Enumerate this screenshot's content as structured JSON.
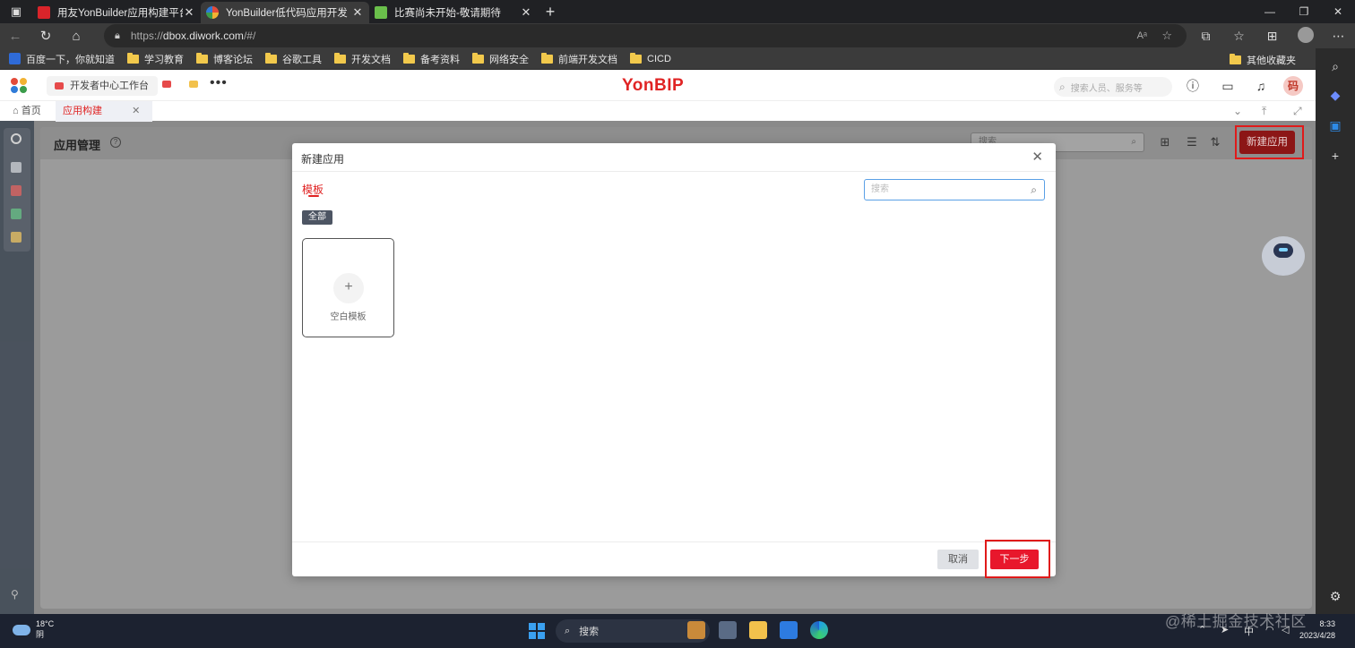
{
  "browser": {
    "tabs": [
      {
        "title": "用友YonBuilder应用构建平台-可可",
        "active": false,
        "favicon_color": "#d9242a"
      },
      {
        "title": "YonBuilder低代码应用开发",
        "active": true,
        "favicon_color": "#e34b3a"
      },
      {
        "title": "比赛尚未开始-敬请期待",
        "active": false,
        "favicon_color": "#6abf4b"
      }
    ],
    "url_prefix": "https://",
    "url_host": "dbox.diwork.com",
    "url_path": "/#/",
    "bookmarks": [
      "百度一下，你就知道",
      "学习教育",
      "博客论坛",
      "谷歌工具",
      "开发文档",
      "备考资料",
      "网络安全",
      "前端开发文档",
      "CICD"
    ],
    "other_bookmarks": "其他收藏夹"
  },
  "app": {
    "workbench": "开发者中心工作台",
    "brand": "YonBIP",
    "search_placeholder": "搜索人员、服务等",
    "avatar_text": "码",
    "tabs": {
      "home": "首页",
      "active": "应用构建"
    }
  },
  "content": {
    "title": "应用管理",
    "search_placeholder": "搜索",
    "new_app_button": "新建应用"
  },
  "modal": {
    "title": "新建应用",
    "tab": "模板",
    "search_placeholder": "搜索",
    "filter_chip": "全部",
    "template_label": "空白模板",
    "cancel": "取消",
    "next": "下一步"
  },
  "taskbar": {
    "temperature": "18°C",
    "weather": "阴",
    "search": "搜索",
    "time": "8:33",
    "date": "2023/4/28",
    "ime": "中"
  },
  "watermark": "@稀土掘金技术社区"
}
